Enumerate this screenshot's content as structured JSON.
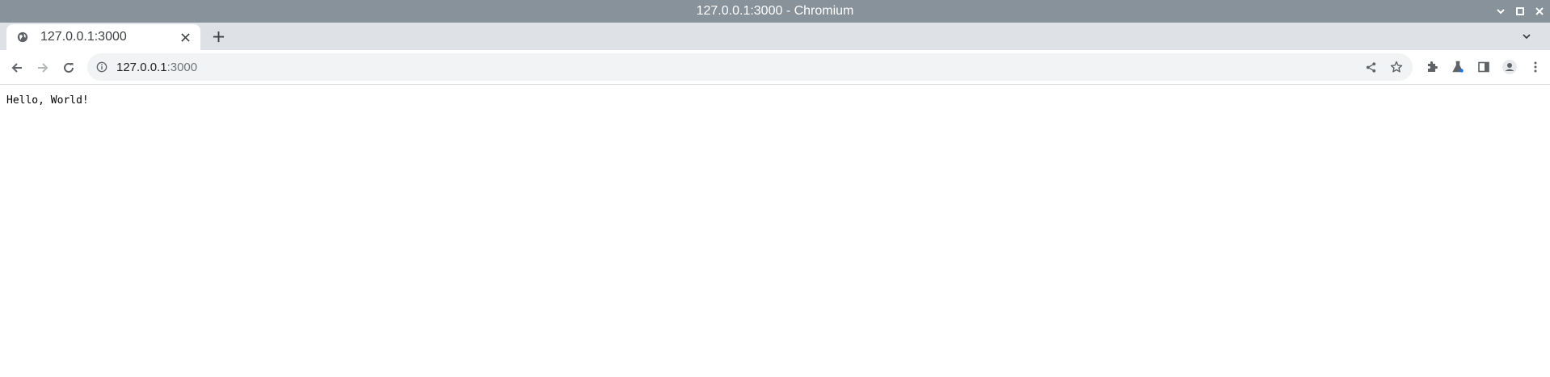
{
  "window": {
    "title": "127.0.0.1:3000 - Chromium",
    "controls": [
      "minimize-icon",
      "maximize-icon",
      "close-icon"
    ]
  },
  "tabs": [
    {
      "title": "127.0.0.1:3000",
      "favicon": "globe-icon",
      "active": true
    }
  ],
  "toolbar": {
    "back_icon": "arrow-left-icon",
    "forward_icon": "arrow-right-icon",
    "reload_icon": "reload-icon",
    "url_host": "127.0.0.1",
    "url_port": ":3000",
    "site_info_icon": "info-icon",
    "omnibox_actions": [
      "share-icon",
      "star-icon"
    ],
    "right_actions": [
      "extensions-icon",
      "labs-icon",
      "side-panel-icon",
      "profile-icon",
      "menu-icon"
    ]
  },
  "page": {
    "body_text": "Hello, World!"
  },
  "colors": {
    "titlebar_bg": "#87929a",
    "tabstrip_bg": "#dee1e6",
    "omnibox_bg": "#f1f3f4",
    "icon_color": "#5f6368"
  }
}
